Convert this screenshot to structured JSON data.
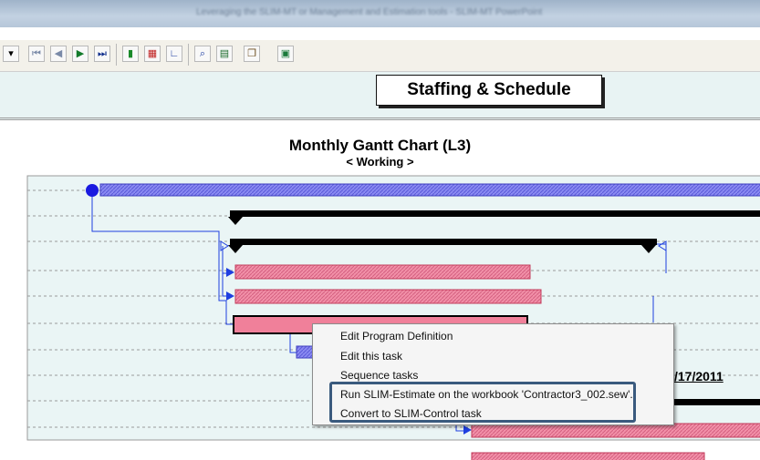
{
  "window": {
    "title": "Leveraging the SLIM-MT or Management and Estimation tools - SLIM-MT PowerPoint"
  },
  "toolbar": {
    "buttons": [
      {
        "name": "dropdown-arrow-icon",
        "glyph": "▾"
      },
      {
        "name": "first-record-icon",
        "glyph": "⏮"
      },
      {
        "name": "previous-record-icon",
        "glyph": "◀"
      },
      {
        "name": "next-record-icon",
        "glyph": "▶"
      },
      {
        "name": "last-record-icon",
        "glyph": "⏭"
      },
      {
        "name": "bar-chart-icon",
        "glyph": "▮"
      },
      {
        "name": "grid-view-icon",
        "glyph": "▦"
      },
      {
        "name": "line-chart-icon",
        "glyph": "∟"
      },
      {
        "name": "zoom-icon",
        "glyph": "⌕"
      },
      {
        "name": "report-icon",
        "glyph": "▤"
      },
      {
        "name": "copy-icon",
        "glyph": "❐"
      },
      {
        "name": "settings-icon",
        "glyph": "▣"
      }
    ]
  },
  "header": {
    "staffing_button": "Staffing & Schedule"
  },
  "chart": {
    "title": "Monthly Gantt Chart  (L3)",
    "subtitle": "< Working >",
    "date_label": "/17/2011"
  },
  "context_menu": {
    "items": [
      "Edit Program Definition",
      "Edit this task",
      "Sequence tasks",
      "Run SLIM-Estimate on the workbook 'Contractor3_002.sew'.",
      "Convert to SLIM-Control task"
    ]
  },
  "colors": {
    "summary_bar": "#7b7bf0",
    "task_bar": "#f0809a",
    "milestone": "#000000",
    "link_line": "#1f3fe0",
    "highlight_border": "#3a5a7e"
  }
}
